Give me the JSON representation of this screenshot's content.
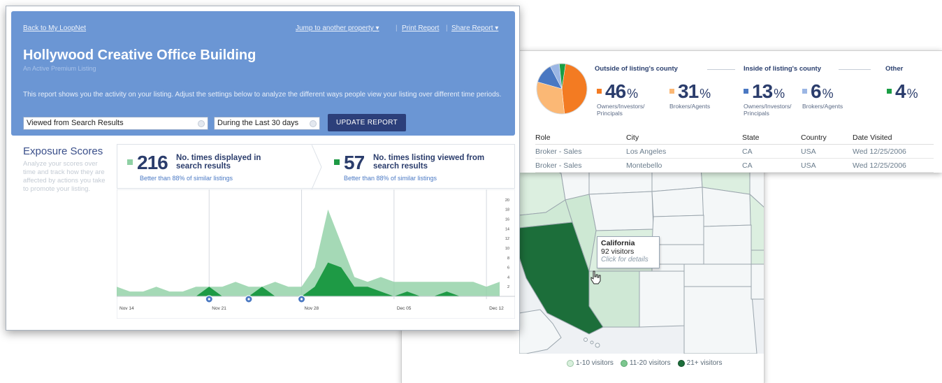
{
  "report": {
    "back_link": "Back to My LoopNet",
    "jump_link": "Jump to another property ▾",
    "print_link": "Print Report",
    "share_link": "Share Report ▾",
    "title": "Hollywood Creative Office Building",
    "subtitle": "An Active Premium Listing",
    "description": "This report shows you the activity on your listing. Adjust the settings below to analyze the different ways people view your listing over different time periods.",
    "view_select": "Viewed from Search Results",
    "period_select": "During the Last 30 days",
    "update_button": "UPDATE REPORT",
    "exposure_title": "Exposure Scores",
    "exposure_desc": "Analyze your scores over time and track how they are affected by actions you take to promote your listing.",
    "stat1": {
      "value": "216",
      "label_line1": "No. times displayed in",
      "label_line2": "search results",
      "comparison": "Better than 88% of similar listings"
    },
    "stat2": {
      "value": "57",
      "label_line1": "No. times listing viewed from",
      "label_line2": "search results",
      "comparison": "Better than 88% of similar listings"
    }
  },
  "colors": {
    "header_blue": "#6b96d4",
    "navy": "#2b3d6c",
    "light_green": "#8fd0a4",
    "dark_green": "#1e9a45",
    "orange": "#f37b22",
    "light_orange": "#fbb875",
    "blue": "#4a78c2",
    "light_blue": "#9bb6e4",
    "green": "#1a9e44"
  },
  "chart_data": {
    "type": "area",
    "x": [
      "Nov 14",
      "Nov 15",
      "Nov 16",
      "Nov 17",
      "Nov 18",
      "Nov 19",
      "Nov 20",
      "Nov 21",
      "Nov 22",
      "Nov 23",
      "Nov 24",
      "Nov 25",
      "Nov 26",
      "Nov 27",
      "Nov 28",
      "Nov 29",
      "Nov 30",
      "Dec 01",
      "Dec 02",
      "Dec 03",
      "Dec 04",
      "Dec 05",
      "Dec 06",
      "Dec 07",
      "Dec 08",
      "Dec 09",
      "Dec 10",
      "Dec 11",
      "Dec 12",
      "Dec 13"
    ],
    "x_tick_labels": [
      "Nov 14",
      "Nov 21",
      "Nov 28",
      "Dec 05",
      "Dec 12"
    ],
    "y_ticks": [
      2,
      4,
      6,
      8,
      10,
      12,
      14,
      16,
      18,
      20
    ],
    "ylim": [
      0,
      21
    ],
    "series": [
      {
        "values": [
          2,
          1,
          1,
          2,
          1,
          1,
          2,
          2,
          2,
          3,
          2,
          2,
          3,
          2,
          2,
          6,
          18,
          11,
          4,
          3,
          4,
          3,
          3,
          3,
          3,
          3,
          3,
          3,
          2,
          3
        ]
      },
      {
        "values": [
          0,
          0,
          0,
          0,
          0,
          0,
          0,
          2,
          0,
          0,
          0,
          2,
          0,
          0,
          0,
          2,
          7,
          6,
          2,
          2,
          1,
          0,
          1,
          0,
          0,
          1,
          0,
          0,
          0,
          0
        ]
      }
    ],
    "event_markers": [
      "Nov 21",
      "Nov 24",
      "Nov 28"
    ]
  },
  "visitors": {
    "outside_header": "Outside of listing's county",
    "inside_header": "Inside of listing's county",
    "other_header": "Other",
    "pie": [
      {
        "value": 46,
        "color": "#f37b22"
      },
      {
        "value": 31,
        "color": "#fbb875"
      },
      {
        "value": 13,
        "color": "#4a78c2"
      },
      {
        "value": 6,
        "color": "#9bb6e4"
      },
      {
        "value": 4,
        "color": "#1a9e44"
      }
    ],
    "stats": [
      {
        "num": "46",
        "pct": "%",
        "label": "Owners/Investors/",
        "label2": "Principals",
        "color": "#f37b22"
      },
      {
        "num": "31",
        "pct": "%",
        "label": "Brokers/Agents",
        "label2": "",
        "color": "#fbb875"
      },
      {
        "num": "13",
        "pct": "%",
        "label": "Owners/Investors/",
        "label2": "Principals",
        "color": "#4a78c2"
      },
      {
        "num": "6",
        "pct": "%",
        "label": "Brokers/Agents",
        "label2": "",
        "color": "#9bb6e4"
      },
      {
        "num": "4",
        "pct": "%",
        "label": "",
        "label2": "",
        "color": "#1a9e44"
      }
    ],
    "table": {
      "headers": [
        "Role",
        "City",
        "State",
        "Country",
        "Date Visited"
      ],
      "rows": [
        [
          "Broker - Sales",
          "Los Angeles",
          "CA",
          "USA",
          "Wed 12/25/2006"
        ],
        [
          "Broker - Sales",
          "Montebello",
          "CA",
          "USA",
          "Wed 12/25/2006"
        ]
      ]
    }
  },
  "map": {
    "tooltip_title": "California",
    "tooltip_visitors": "92 visitors",
    "tooltip_hint": "Click for details",
    "legend": [
      {
        "label": "1-10 visitors",
        "color": "#d8efdc"
      },
      {
        "label": "11-20 visitors",
        "color": "#7cc68f"
      },
      {
        "label": "21+ visitors",
        "color": "#1c6e3a"
      }
    ]
  }
}
